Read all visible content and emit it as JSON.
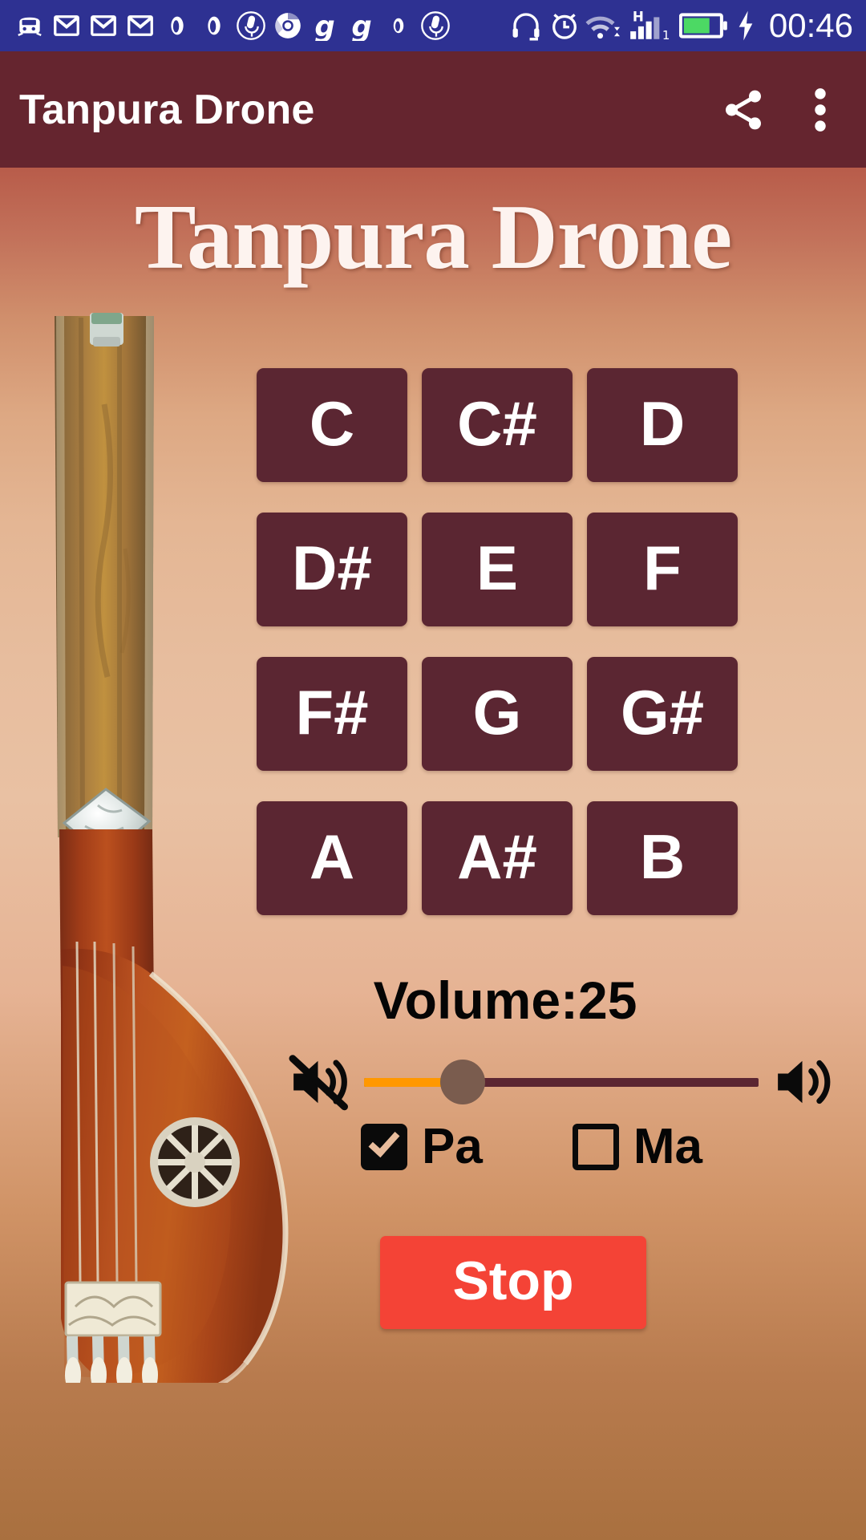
{
  "statusbar": {
    "time": "00:46",
    "left_icons": [
      {
        "name": "train-icon"
      },
      {
        "name": "gmail-icon"
      },
      {
        "name": "gmail-icon"
      },
      {
        "name": "gmail-icon"
      },
      {
        "name": "vodafone-icon"
      },
      {
        "name": "vodafone-icon"
      },
      {
        "name": "microphone-circle-icon"
      },
      {
        "name": "chrome-icon"
      },
      {
        "name": "g-logo-icon"
      },
      {
        "name": "g-logo-icon"
      },
      {
        "name": "vodafone-icon"
      },
      {
        "name": "microphone-circle-icon"
      }
    ],
    "right_icons": [
      {
        "name": "headphones-icon"
      },
      {
        "name": "alarm-clock-icon"
      },
      {
        "name": "wifi-icon"
      },
      {
        "name": "mobile-signal-h-icon",
        "label": "H",
        "sim": "1"
      },
      {
        "name": "battery-icon"
      },
      {
        "name": "charging-bolt-icon"
      }
    ],
    "background_color": "#2E3192"
  },
  "appbar": {
    "title": "Tanpura Drone",
    "share_label": "Share",
    "overflow_label": "More options",
    "background_color": "#65252F"
  },
  "main": {
    "logo_text": "Tanpura Drone",
    "instrument": "tanpura-illustration",
    "notes": [
      "C",
      "C#",
      "D",
      "D#",
      "E",
      "F",
      "F#",
      "G",
      "G#",
      "A",
      "A#",
      "B"
    ],
    "note_button_color": "#5B2632",
    "volume": {
      "label": "Volume:25",
      "value": 25,
      "min": 0,
      "max": 100,
      "fill_color": "#FF9800",
      "track_color": "#5B2632",
      "thumb_color": "#7A5C4E",
      "mute_icon": "volume-mute-icon",
      "max_icon": "volume-up-icon"
    },
    "checkboxes": [
      {
        "label": "Pa",
        "checked": true
      },
      {
        "label": "Ma",
        "checked": false
      }
    ],
    "stop_button": {
      "label": "Stop",
      "color": "#F44336"
    }
  }
}
